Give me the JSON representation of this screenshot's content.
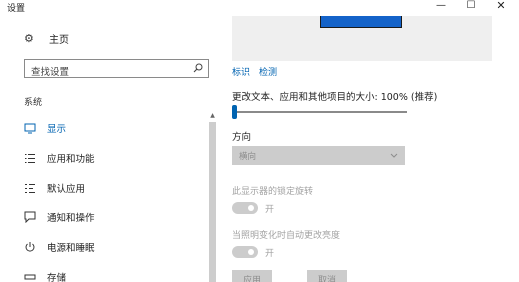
{
  "window": {
    "title": "设置",
    "minimize_glyph": "—",
    "maximize_glyph": "☐",
    "close_glyph": "✕"
  },
  "sidebar": {
    "home": {
      "label": "主页",
      "icon": "gear-icon"
    },
    "search": {
      "placeholder": "查找设置",
      "value": ""
    },
    "section": "系统",
    "items": [
      {
        "label": "显示",
        "icon": "monitor-icon",
        "active": true
      },
      {
        "label": "应用和功能",
        "icon": "apps-list-icon",
        "active": false
      },
      {
        "label": "默认应用",
        "icon": "default-apps-icon",
        "active": false
      },
      {
        "label": "通知和操作",
        "icon": "notification-icon",
        "active": false
      },
      {
        "label": "电源和睡眠",
        "icon": "power-icon",
        "active": false
      },
      {
        "label": "存储",
        "icon": "storage-icon",
        "active": false
      }
    ]
  },
  "main": {
    "links": {
      "identify": "标识",
      "detect": "检测"
    },
    "scale": {
      "label": "更改文本、应用和其他项目的大小: 100% (推荐)",
      "value_fraction": 0.0
    },
    "orientation": {
      "label": "方向",
      "value": "横向"
    },
    "rotation_lock": {
      "label": "此显示器的锁定旋转",
      "state": "开",
      "on": true
    },
    "auto_brightness": {
      "label": "当照明变化时自动更改亮度",
      "state": "开",
      "on": true
    },
    "buttons": {
      "apply": "应用",
      "cancel": "取消"
    }
  },
  "colors": {
    "accent": "#0063b1",
    "monitor": "#1463c9",
    "disabled": "#cccccc",
    "disabled_text": "#a3a3a3"
  }
}
